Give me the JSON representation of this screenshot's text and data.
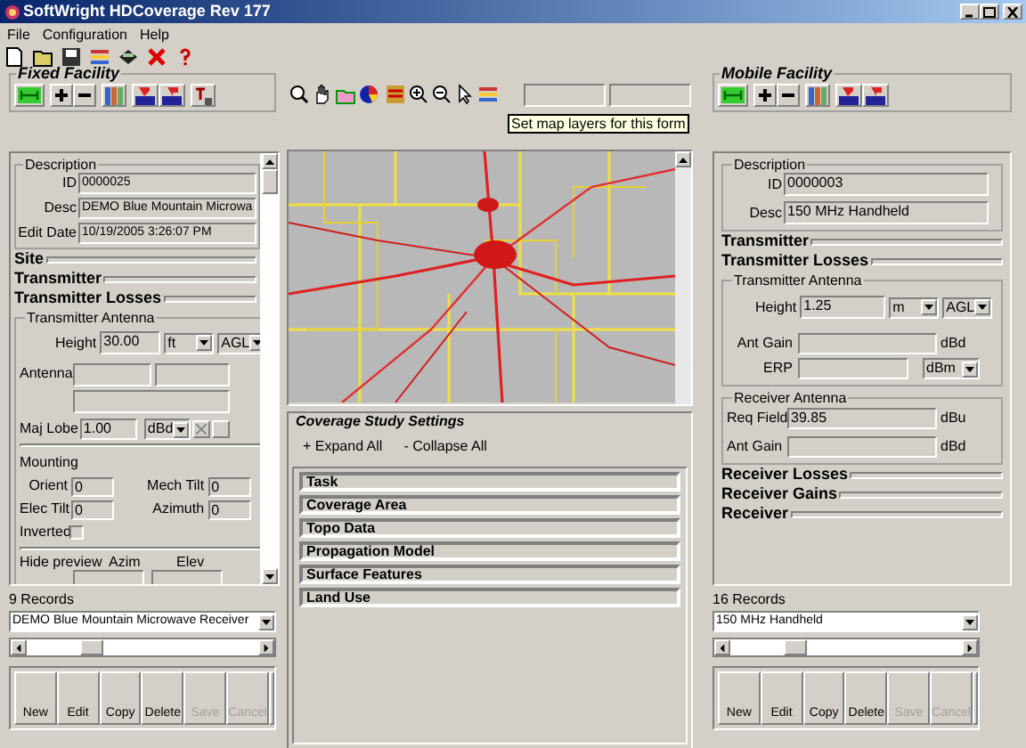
{
  "window": {
    "title": "SoftWright HDCoverage Rev 177"
  },
  "menu": [
    "File",
    "Configuration",
    "Help"
  ],
  "fixed_facility": {
    "title": "Fixed Facility"
  },
  "mobile_facility": {
    "title": "Mobile Facility"
  },
  "tooltip": "Set map layers for this form",
  "fixed_panel": {
    "description": {
      "title": "Description",
      "fields": [
        {
          "label": "ID",
          "value": "0000025"
        },
        {
          "label": "Desc",
          "value": "DEMO Blue Mountain Microwa"
        },
        {
          "label": "Edit Date",
          "value": "10/19/2005 3:26:07 PM"
        }
      ]
    },
    "sections": [
      "Site",
      "Transmitter",
      "Transmitter Losses"
    ],
    "antenna": {
      "title": "Transmitter Antenna",
      "height": {
        "label": "Height",
        "value": "30.00",
        "unit": "ft",
        "reference": "AGL"
      },
      "antenna_label": "Antenna",
      "maj_lobe": {
        "label": "Maj Lobe",
        "value": "1.00",
        "unit": "dBd"
      },
      "mounting": {
        "title": "Mounting",
        "fields": [
          {
            "label": "Orient",
            "value": "0"
          },
          {
            "label": "Mech Tilt",
            "value": "0"
          },
          {
            "label": "Elec Tilt",
            "value": "0"
          },
          {
            "label": "Azimuth",
            "value": "0"
          }
        ],
        "inverted": {
          "label": "Inverted",
          "checked": false
        }
      },
      "preview": {
        "label": "Hide preview",
        "azim": "Azim",
        "elev": "Elev"
      }
    }
  },
  "fixed_records": {
    "count": "9 Records",
    "selected": "DEMO Blue Mountain Microwave Receiver",
    "buttons": [
      {
        "label": "New",
        "disabled": false
      },
      {
        "label": "Edit",
        "disabled": false
      },
      {
        "label": "Copy",
        "disabled": false
      },
      {
        "label": "Delete",
        "disabled": false
      },
      {
        "label": "Save",
        "disabled": true
      },
      {
        "label": "Cancel",
        "disabled": true
      }
    ]
  },
  "coverage": {
    "title": "Coverage Study Settings",
    "expand": "+ Expand All",
    "collapse": "- Collapse All",
    "sections": [
      "Task",
      "Coverage Area",
      "Topo Data",
      "Propagation Model",
      "Surface Features",
      "Land Use"
    ]
  },
  "mobile_panel": {
    "description": {
      "title": "Description",
      "fields": [
        {
          "label": "ID",
          "value": "0000003"
        },
        {
          "label": "Desc",
          "value": "150 MHz Handheld"
        }
      ]
    },
    "sections_top": [
      "Transmitter",
      "Transmitter Losses"
    ],
    "transmitter_antenna": {
      "title": "Transmitter Antenna",
      "height": {
        "label": "Height",
        "value": "1.25",
        "unit": "m",
        "reference": "AGL"
      },
      "fields": [
        {
          "label": "Ant Gain",
          "unit": "dBd",
          "kind": "text"
        },
        {
          "label": "ERP",
          "unit": "dBm",
          "kind": "select"
        }
      ]
    },
    "receiver_antenna": {
      "title": "Receiver Antenna",
      "fields": [
        {
          "label": "Req Field",
          "value": "39.85",
          "unit": "dBu"
        },
        {
          "label": "Ant Gain",
          "unit": "dBd"
        }
      ]
    },
    "sections_bottom": [
      "Receiver Losses",
      "Receiver Gains",
      "Receiver"
    ]
  },
  "mobile_records": {
    "count": "16 Records",
    "selected": "150 MHz Handheld",
    "buttons": [
      {
        "label": "New",
        "disabled": false
      },
      {
        "label": "Edit",
        "disabled": false
      },
      {
        "label": "Copy",
        "disabled": false
      },
      {
        "label": "Delete",
        "disabled": false
      },
      {
        "label": "Save",
        "disabled": true
      },
      {
        "label": "Cancel",
        "disabled": true
      }
    ]
  }
}
